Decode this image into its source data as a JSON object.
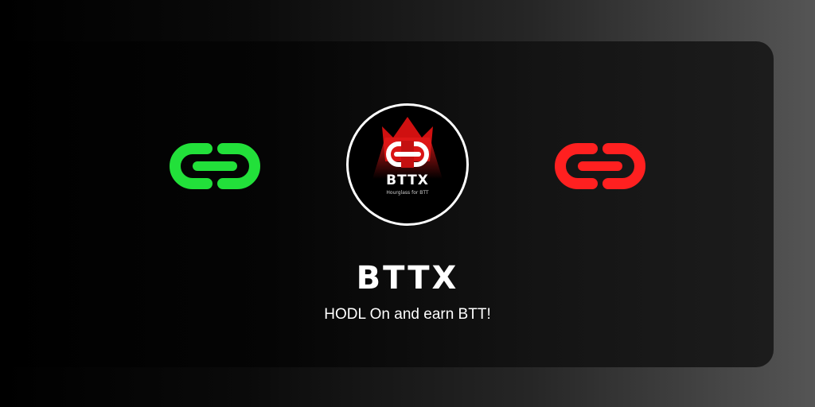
{
  "brand": {
    "title": "BTTX",
    "tagline": "HODL On and earn BTT!"
  },
  "logo": {
    "name": "BTTX",
    "subtitle": "Hourglass for BTT"
  },
  "icons": {
    "left": "link-icon",
    "right": "link-icon",
    "crown": "crown-icon"
  },
  "colors": {
    "left_link": "#22e03a",
    "right_link": "#ff2020",
    "crown": "#e01818",
    "text": "#ffffff"
  }
}
